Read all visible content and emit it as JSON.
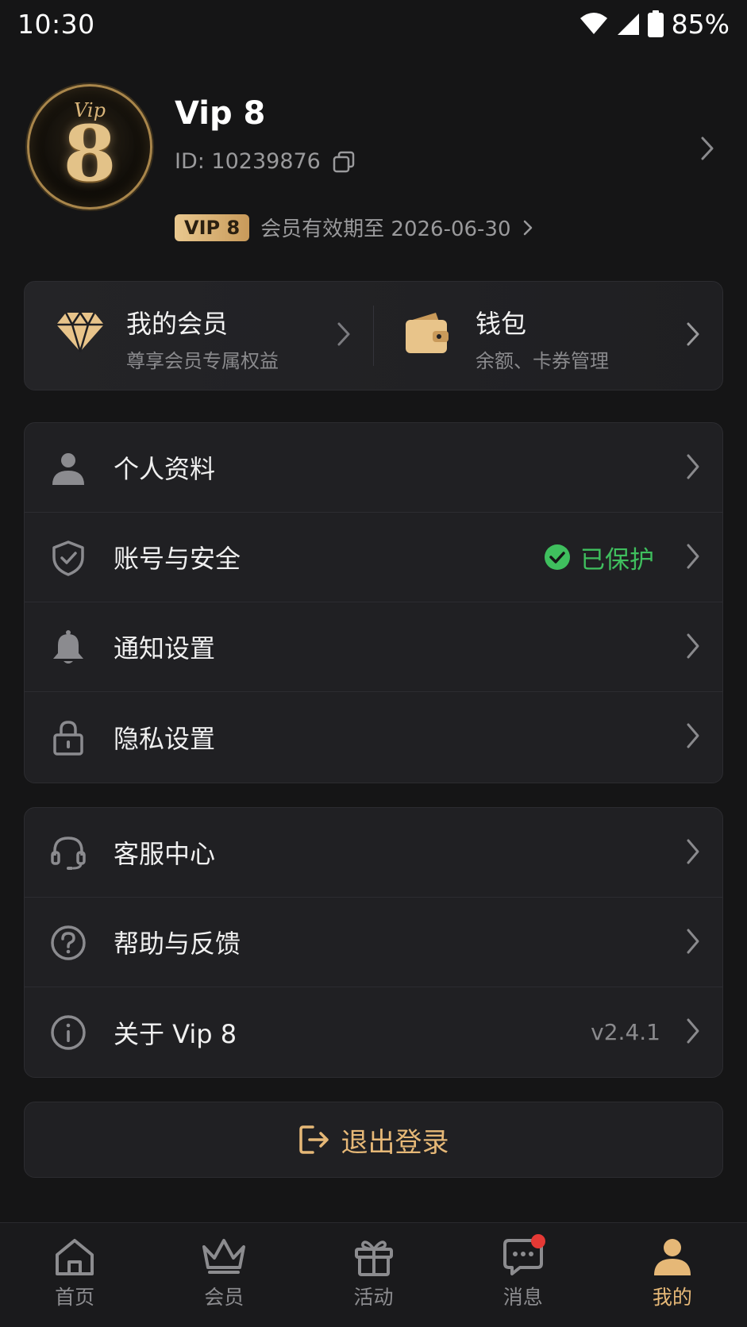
{
  "status_bar": {
    "time": "10:30",
    "battery": "85%"
  },
  "profile": {
    "avatar_vip": "Vip",
    "avatar_num": "8",
    "name": "Vip 8",
    "id": "ID: 10239876",
    "vip_badge": "VIP 8",
    "expire": "会员有效期至 2026-06-30"
  },
  "quick": [
    {
      "title": "我的会员",
      "sub": "尊享会员专属权益",
      "icon": "diamond-icon"
    },
    {
      "title": "钱包",
      "sub": "余额、卡券管理",
      "icon": "wallet-icon"
    }
  ],
  "settings": {
    "profile": "个人资料",
    "security": "账号与安全",
    "security_status": "已保护",
    "notify": "通知设置",
    "privacy": "隐私设置"
  },
  "support": {
    "service": "客服中心",
    "help": "帮助与反馈",
    "about": "关于 Vip 8",
    "version": "v2.4.1"
  },
  "logout": "退出登录",
  "tabs": [
    {
      "label": "首页"
    },
    {
      "label": "会员"
    },
    {
      "label": "活动"
    },
    {
      "label": "消息"
    },
    {
      "label": "我的"
    }
  ],
  "colors": {
    "accent_gold": "#e6b877",
    "success_green": "#3fbf5e",
    "badge_red": "#e53935",
    "background": "#151516"
  }
}
